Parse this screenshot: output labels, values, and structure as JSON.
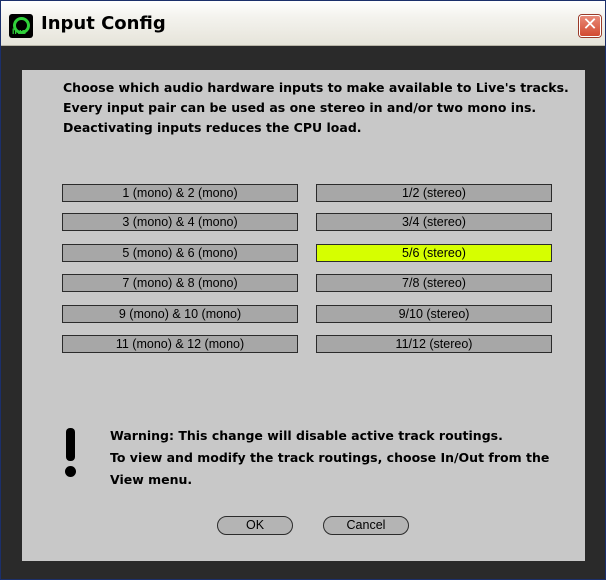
{
  "window": {
    "title": "Input Config",
    "app_icon": "live-icon",
    "app_icon_text": "live",
    "close_icon": "close-icon"
  },
  "intro_lines": [
    "Choose which audio hardware inputs to make available to Live's tracks.",
    "Every input pair can be used as one stereo in and/or two mono ins.",
    "Deactivating inputs reduces the CPU load."
  ],
  "inputs": [
    {
      "mono": "1 (mono) & 2 (mono)",
      "stereo": "1/2 (stereo)",
      "mono_on": false,
      "stereo_on": false
    },
    {
      "mono": "3 (mono) & 4 (mono)",
      "stereo": "3/4 (stereo)",
      "mono_on": false,
      "stereo_on": false
    },
    {
      "mono": "5 (mono) & 6 (mono)",
      "stereo": "5/6 (stereo)",
      "mono_on": false,
      "stereo_on": true
    },
    {
      "mono": "7 (mono) & 8 (mono)",
      "stereo": "7/8 (stereo)",
      "mono_on": false,
      "stereo_on": false
    },
    {
      "mono": "9 (mono) & 10 (mono)",
      "stereo": "9/10 (stereo)",
      "mono_on": false,
      "stereo_on": false
    },
    {
      "mono": "11 (mono) & 12 (mono)",
      "stereo": "11/12 (stereo)",
      "mono_on": false,
      "stereo_on": false
    }
  ],
  "warning": {
    "icon": "exclamation-icon",
    "lines": [
      "Warning: This change will disable active track routings.",
      "To view and modify the track routings, choose In/Out from the",
      "View menu."
    ]
  },
  "buttons": {
    "ok": "OK",
    "cancel": "Cancel"
  },
  "colors": {
    "active": "#d6ff00",
    "inactive": "#a7a7a7",
    "panel": "#c8c8c8",
    "frame": "#2a2a2a"
  }
}
